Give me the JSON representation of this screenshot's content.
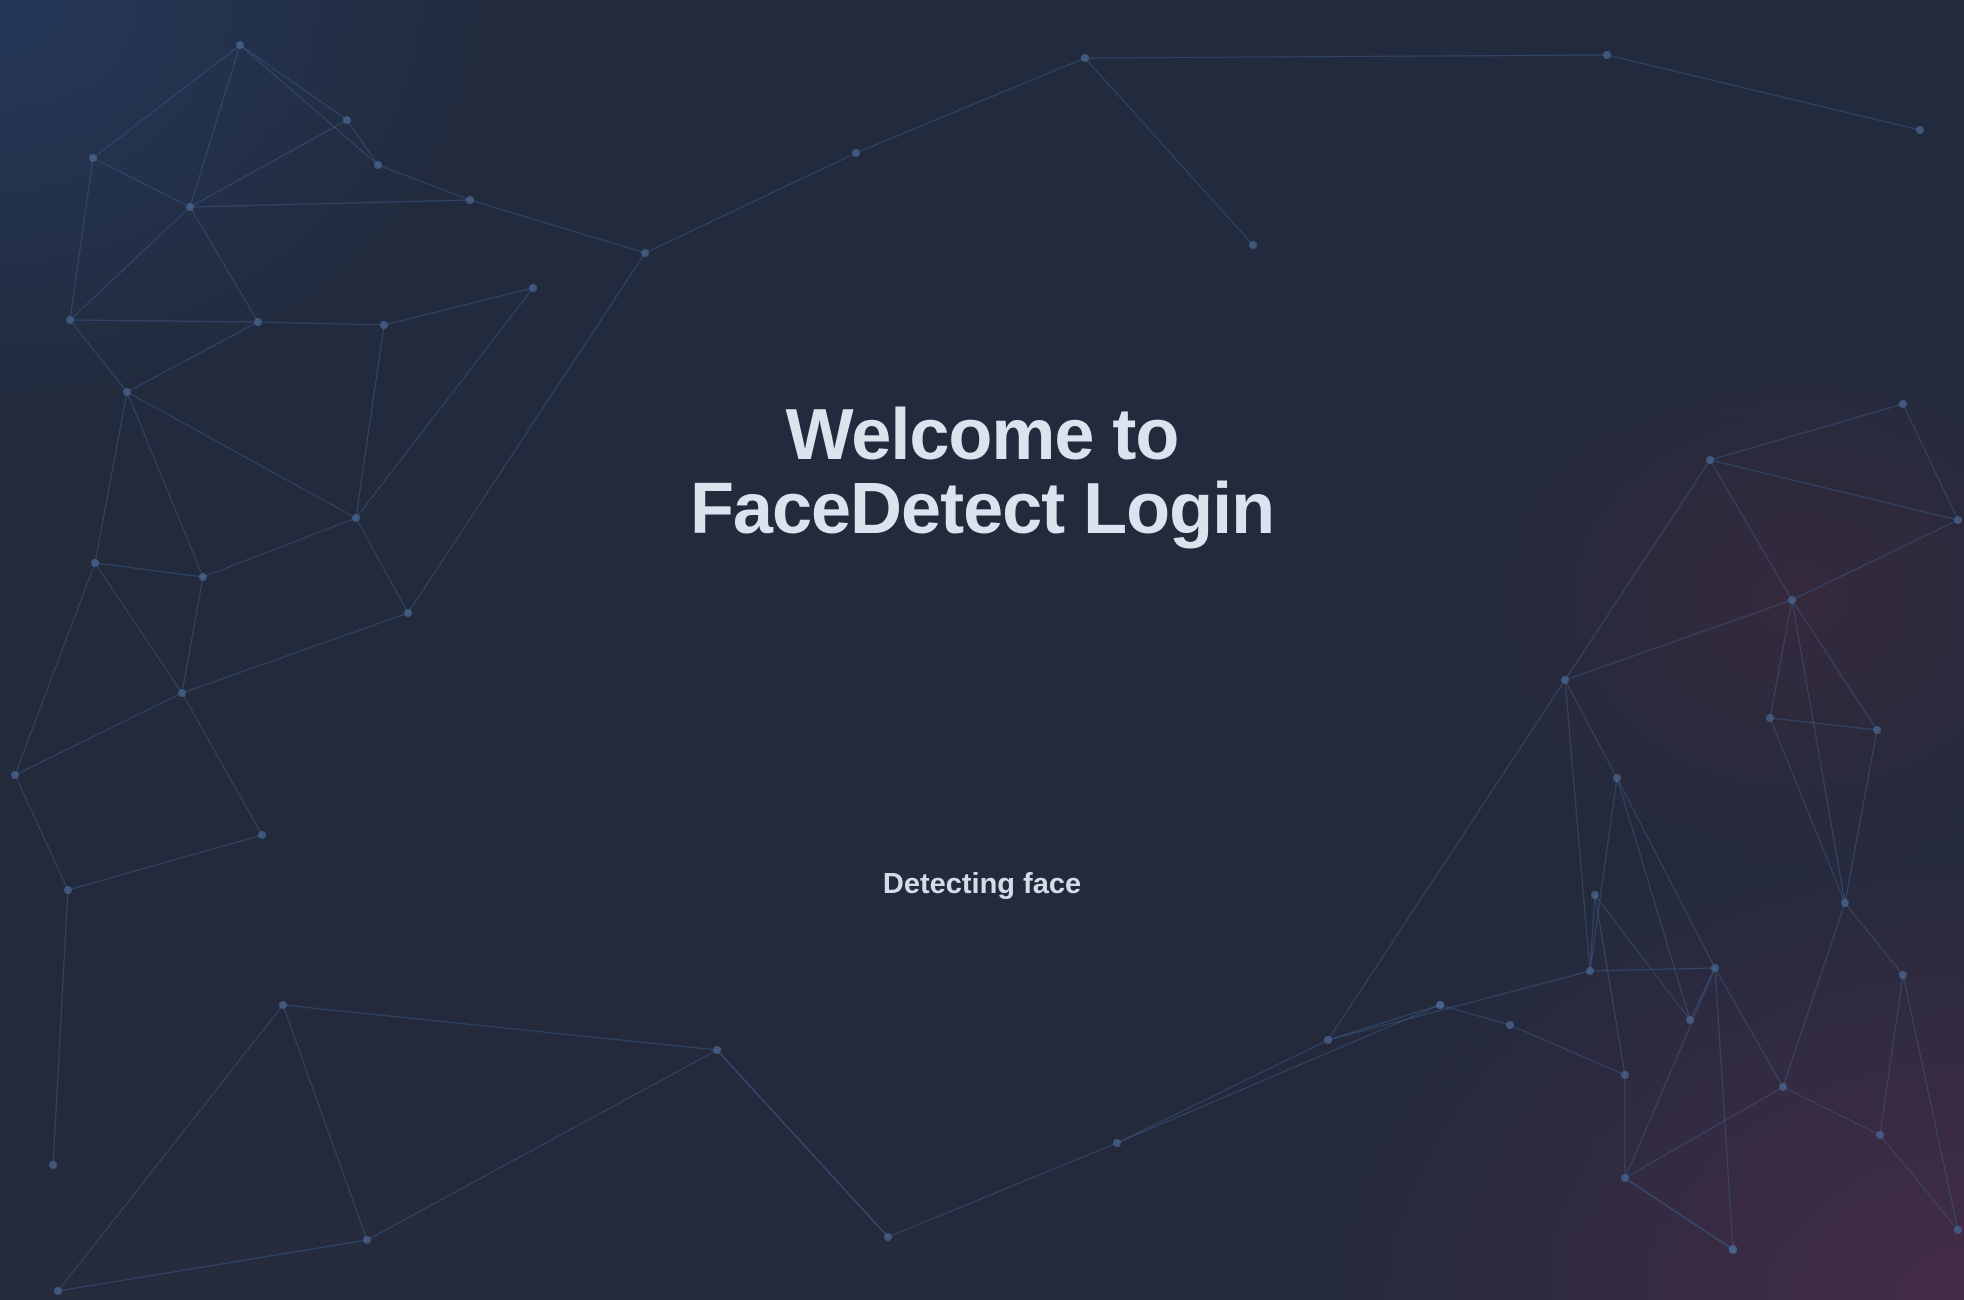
{
  "page": {
    "title_line1": "Welcome to",
    "title_line2": "FaceDetect Login",
    "status_text": "Detecting face"
  },
  "theme": {
    "background": "#222b3d",
    "text": "#dde3ee",
    "network_line": "#3d5a85"
  }
}
